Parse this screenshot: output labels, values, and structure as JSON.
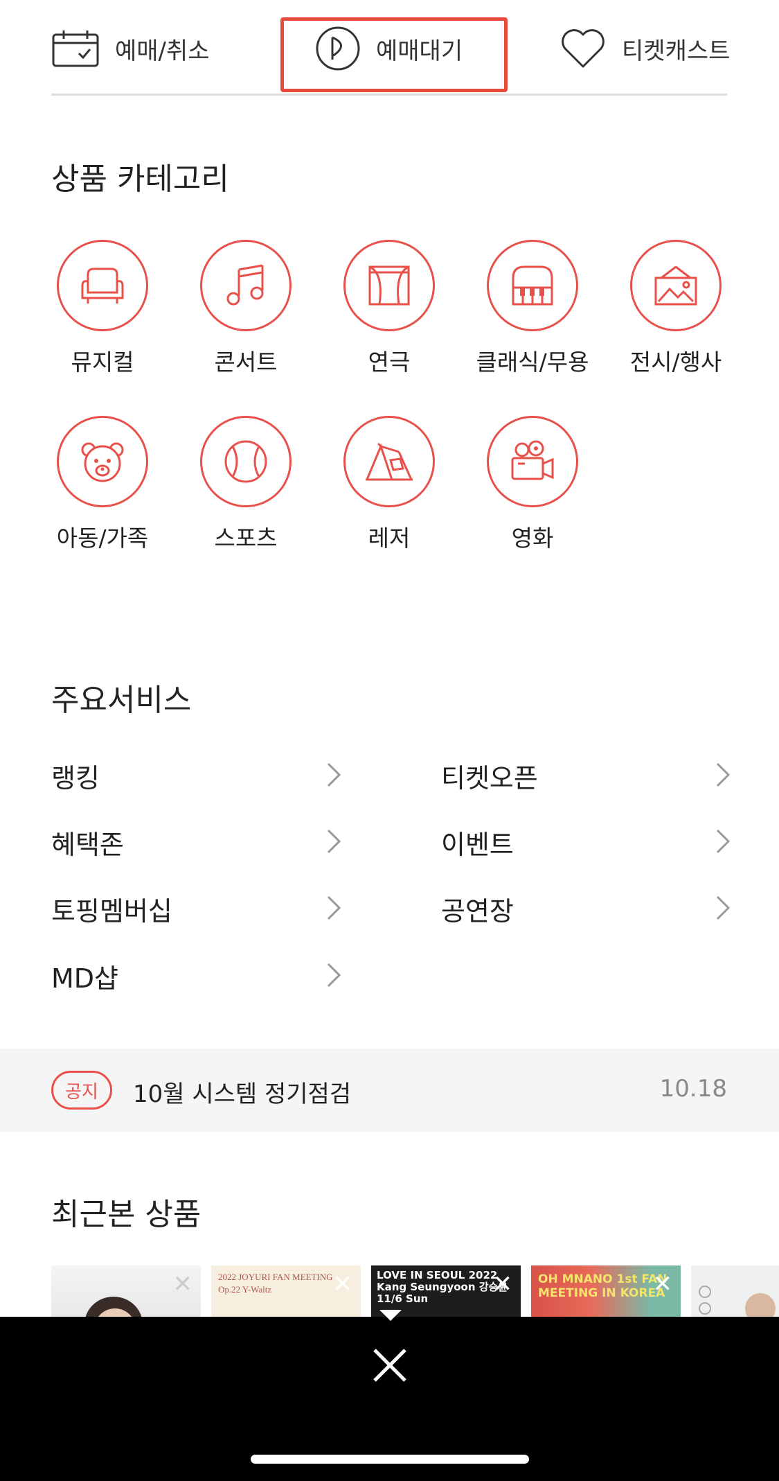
{
  "top_nav": {
    "reserve_cancel": "예매/취소",
    "queue": "예매대기",
    "ticketcast": "티켓캐스트"
  },
  "categories": {
    "title": "상품 카테고리",
    "items": [
      {
        "label": "뮤지컬",
        "icon": "armchair-icon"
      },
      {
        "label": "콘서트",
        "icon": "music-note-icon"
      },
      {
        "label": "연극",
        "icon": "theater-curtain-icon"
      },
      {
        "label": "클래식/무용",
        "icon": "piano-icon"
      },
      {
        "label": "전시/행사",
        "icon": "picture-frame-icon"
      },
      {
        "label": "아동/가족",
        "icon": "teddy-bear-icon"
      },
      {
        "label": "스포츠",
        "icon": "ball-icon"
      },
      {
        "label": "레저",
        "icon": "tent-icon"
      },
      {
        "label": "영화",
        "icon": "movie-camera-icon"
      }
    ]
  },
  "services": {
    "title": "주요서비스",
    "items": [
      "랭킹",
      "티켓오픈",
      "혜택존",
      "이벤트",
      "토핑멤버십",
      "공연장",
      "MD샵"
    ]
  },
  "notice": {
    "badge": "공지",
    "text": "10월 시스템 정기점검",
    "date": "10.18"
  },
  "recent": {
    "title": "최근본 상품",
    "thumbs": [
      {
        "text": ""
      },
      {
        "text": "2022 JOYURI FAN MEETING Op.22 Y-Waltz"
      },
      {
        "text": "LOVE IN SEOUL 2022 Kang Seungyoon 강승윤 11/6 Sun"
      },
      {
        "text": "OH MNANO 1st FAN MEETING IN KOREA"
      },
      {
        "text": ""
      }
    ]
  },
  "colors": {
    "accent": "#e8504a",
    "highlight": "#e74c3c"
  }
}
